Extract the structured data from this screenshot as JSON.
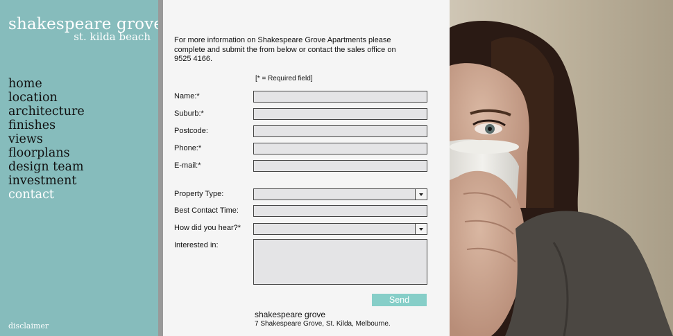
{
  "brand": {
    "title": "shakespeare grove",
    "subtitle": "st. kilda beach"
  },
  "nav": {
    "items": [
      "home",
      "location",
      "architecture",
      "finishes",
      "views",
      "floorplans",
      "design team",
      "investment",
      "contact"
    ],
    "active": "contact"
  },
  "disclaimer": "disclaimer",
  "form": {
    "intro": "For more information on Shakespeare Grove Apartments  please complete and submit the from below or contact the sales office on 9525 4166.",
    "required_note": "[* = Required field]",
    "fields": {
      "name": {
        "label": "Name:*",
        "value": ""
      },
      "suburb": {
        "label": "Suburb:*",
        "value": ""
      },
      "postcode": {
        "label": "Postcode:",
        "value": ""
      },
      "phone": {
        "label": "Phone:*",
        "value": ""
      },
      "email": {
        "label": "E-mail:*",
        "value": ""
      },
      "property_type": {
        "label": "Property Type:",
        "selected": ""
      },
      "contact_time": {
        "label": "Best Contact Time:",
        "value": ""
      },
      "how_heard": {
        "label": "How did you hear?*",
        "selected": ""
      },
      "interested_in": {
        "label": "Interested in:",
        "value": ""
      }
    },
    "send_label": "Send"
  },
  "footer": {
    "name": "shakespeare grove",
    "address": "7 Shakespeare Grove, St. Kilda, Melbourne."
  },
  "colors": {
    "sidebar": "#86bcbc",
    "send_button": "#86cec8",
    "field_bg": "#e4e4e6",
    "form_bg": "#f5f5f5"
  }
}
